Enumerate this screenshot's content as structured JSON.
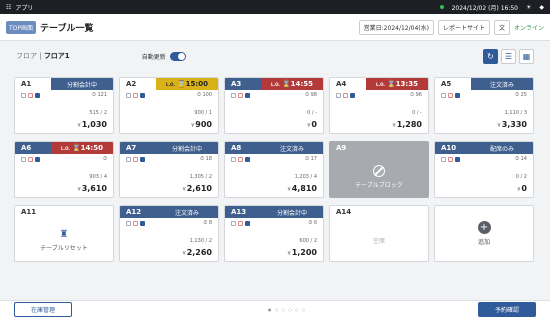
{
  "sysbar": {
    "app": "アプリ",
    "datetime": "2024/12/02 (月) 16:50"
  },
  "header": {
    "top_button": "TOP画面",
    "title": "テーブル一覧",
    "business_date": "営業日:2024/12/04(水)",
    "report_site": "レポートサイト",
    "status": "オンライン"
  },
  "subbar": {
    "floor_label": "フロア",
    "floor": "フロア1",
    "auto_update": "自動更新"
  },
  "tables": [
    {
      "id": "A1",
      "status": "分割会計中",
      "style": "blue",
      "count": "121",
      "sub": "515 / 2",
      "price": "1,030"
    },
    {
      "id": "A2",
      "status": "15:00",
      "style": "yellow",
      "count": "100",
      "sub": "900 / 1",
      "price": "900"
    },
    {
      "id": "A3",
      "status": "14:55",
      "style": "red",
      "count": "98",
      "sub": "0 / -",
      "price": "0"
    },
    {
      "id": "A4",
      "status": "13:35",
      "style": "red",
      "count": "96",
      "sub": "0 / -",
      "price": "1,280"
    },
    {
      "id": "A5",
      "status": "注文済み",
      "style": "blue",
      "count": "25",
      "sub": "1,110 / 3",
      "price": "3,330"
    },
    {
      "id": "A6",
      "status": "14:50",
      "style": "red",
      "count": "",
      "sub": "903 / 4",
      "price": "3,610"
    },
    {
      "id": "A7",
      "status": "分割会計中",
      "style": "blue",
      "count": "18",
      "sub": "1,305 / 2",
      "price": "2,610"
    },
    {
      "id": "A8",
      "status": "注文済み",
      "style": "blue",
      "count": "17",
      "sub": "1,203 / 4",
      "price": "4,810"
    },
    {
      "id": "A9",
      "status": "",
      "style": "blocked",
      "center": "テーブルブロック"
    },
    {
      "id": "A10",
      "status": "配席のみ",
      "style": "blue",
      "count": "14",
      "sub": "0 / 2",
      "price": "0"
    },
    {
      "id": "A11",
      "status": "",
      "style": "reset",
      "center": "テーブルリセット"
    },
    {
      "id": "A12",
      "status": "注文済み",
      "style": "blue",
      "count": "8",
      "sub": "1,130 / 2",
      "price": "2,260"
    },
    {
      "id": "A13",
      "status": "分割会計中",
      "style": "blue",
      "count": "6",
      "sub": "600 / 2",
      "price": "1,200"
    },
    {
      "id": "A14",
      "status": "",
      "style": "empty",
      "center": "空席"
    },
    {
      "id": "",
      "status": "",
      "style": "add",
      "center": "追加"
    }
  ],
  "lo_label": "L.O.",
  "yen": "¥",
  "footer": {
    "left_button": "在庫管理",
    "right_button": "予約確認"
  }
}
